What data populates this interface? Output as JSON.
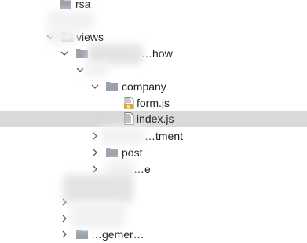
{
  "tree": {
    "rows": [
      {
        "label": "rsa",
        "kind": "folder",
        "expanded": false
      },
      {
        "label": "views",
        "kind": "folder",
        "expanded": true
      },
      {
        "label": "…how",
        "kind": "folder",
        "expanded": true
      },
      {
        "label": "",
        "kind": "folder",
        "expanded": true
      },
      {
        "label": "company",
        "kind": "folder",
        "expanded": true
      },
      {
        "label": "form.js",
        "kind": "file",
        "icon": "js-file-icon"
      },
      {
        "label": "index.js",
        "kind": "file",
        "icon": "js-file-icon",
        "selected": true
      },
      {
        "label": "…tment",
        "kind": "folder",
        "expanded": false
      },
      {
        "label": "post",
        "kind": "folder",
        "expanded": false
      },
      {
        "label": "…e",
        "kind": "folder",
        "expanded": false
      },
      {
        "label": "",
        "kind": "folder",
        "expanded": false
      },
      {
        "label": "",
        "kind": "folder",
        "expanded": false
      },
      {
        "label": "…gemer…",
        "kind": "folder",
        "expanded": false
      }
    ]
  },
  "colors": {
    "folder": "#9aa2ab",
    "js_badge": "#e0a82e",
    "selection": "#d9d9d9"
  }
}
